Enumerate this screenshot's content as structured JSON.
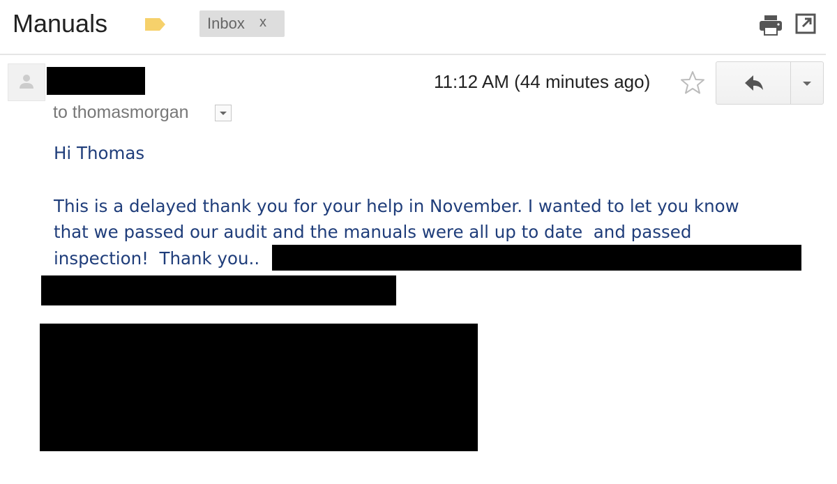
{
  "header": {
    "subject": "Manuals",
    "label_chip": "Inbox",
    "label_chip_remove": "x",
    "label_color": "#f6d16b"
  },
  "message": {
    "recipients": "to thomasmorgan",
    "timestamp": "11:12 AM (44 minutes ago)",
    "body": {
      "greeting": "Hi Thomas",
      "line1": "This is a delayed thank you for your help in November. I wanted to let you know",
      "line2": "that we passed our audit and the manuals were all up to date  and passed",
      "line3": "inspection!  Thank you.."
    }
  },
  "icons": {
    "label": "label-tag-icon",
    "print": "print-icon",
    "popout": "open-in-new-window-icon",
    "avatar": "person-icon",
    "star": "star-outline-icon",
    "reply": "reply-arrow-icon",
    "more": "chevron-down-icon"
  },
  "colors": {
    "body_text": "#1f3d7a",
    "muted_text": "#777777",
    "redaction": "#000000"
  }
}
